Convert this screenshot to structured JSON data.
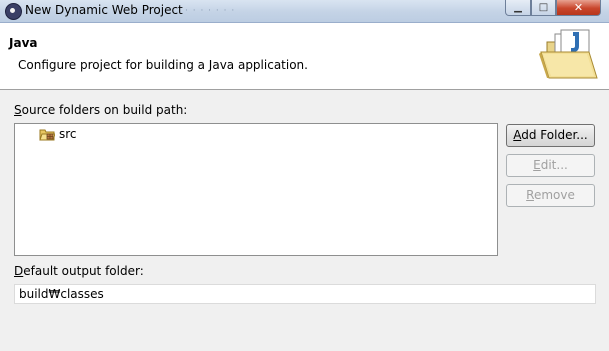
{
  "window": {
    "title": "New Dynamic Web Project",
    "minimize_glyph": "▁",
    "maximize_glyph": "□",
    "close_glyph": "✕"
  },
  "header": {
    "title": "Java",
    "description": "Configure project for building a Java application.",
    "icon": "open-folder-icon"
  },
  "source_folders": {
    "label_mnemonic": "S",
    "label_rest": "ource folders on build path:",
    "items": [
      {
        "label": "src",
        "icon": "source-package-icon"
      }
    ]
  },
  "buttons": {
    "add_folder_mnemonic": "A",
    "add_folder_rest": "dd Folder...",
    "edit_mnemonic": "E",
    "edit_rest": "dit...",
    "remove_mnemonic": "R",
    "remove_rest": "emove"
  },
  "output": {
    "label_mnemonic": "D",
    "label_rest": "efault output folder:",
    "value": "build₩classes"
  },
  "colors": {
    "titlebar": "#c4d3e6",
    "close_button": "#c9462c",
    "header_bg": "#ffffff",
    "dialog_bg": "#f0f0f0"
  }
}
